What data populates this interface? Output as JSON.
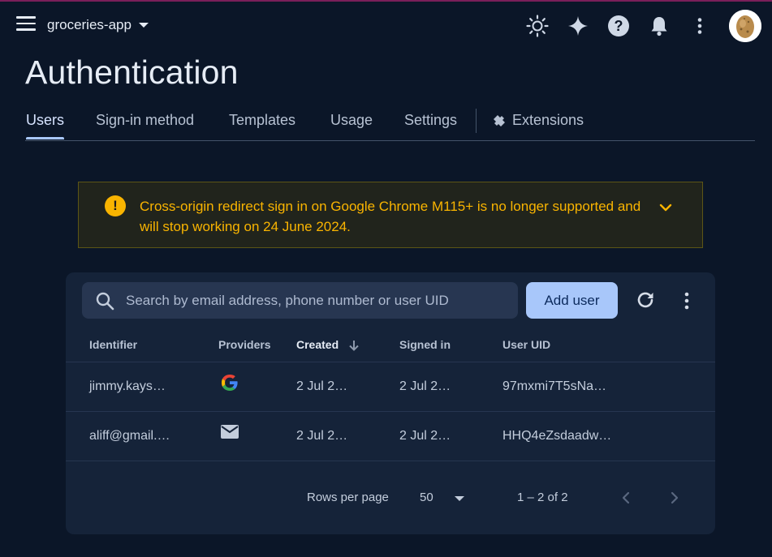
{
  "header": {
    "project_name": "groceries-app",
    "icons": [
      "menu-icon",
      "chevron-down-icon",
      "theme-sun-icon",
      "sparkle-icon",
      "help-icon",
      "notifications-bell-icon",
      "more-vert-icon",
      "avatar"
    ]
  },
  "page": {
    "title": "Authentication"
  },
  "tabs": [
    {
      "label": "Users",
      "active": true
    },
    {
      "label": "Sign-in method"
    },
    {
      "label": "Templates"
    },
    {
      "label": "Usage"
    },
    {
      "label": "Settings"
    },
    {
      "label": "Extensions",
      "icon": "extensions-icon"
    }
  ],
  "banner": {
    "icon": "warning-icon",
    "icon_glyph": "!",
    "text": "Cross-origin redirect sign in on Google Chrome M115+ is no longer supported and will stop working on 24 June 2024."
  },
  "toolbar": {
    "search_placeholder": "Search by email address, phone number or user UID",
    "add_user_label": "Add user"
  },
  "table": {
    "columns": [
      "Identifier",
      "Providers",
      "Created",
      "Signed in",
      "User UID"
    ],
    "sorted_column": "Created",
    "sort_direction": "descending",
    "rows": [
      {
        "identifier": "jimmy.kays…",
        "provider": "google-icon",
        "created": "2 Jul 2…",
        "signed_in": "2 Jul 2…",
        "uid": "97mxmi7T5sNa…"
      },
      {
        "identifier": "aliff@gmail.…",
        "provider": "email-icon",
        "created": "2 Jul 2…",
        "signed_in": "2 Jul 2…",
        "uid": "HHQ4eZsdaadw…"
      }
    ]
  },
  "pagination": {
    "rows_per_page_label": "Rows per page",
    "rows_per_page": "50",
    "range": "1 – 2 of 2"
  },
  "colors": {
    "background": "#0b1628",
    "card": "#152339",
    "accent": "#a8c7fa",
    "warning": "#f9b400"
  }
}
